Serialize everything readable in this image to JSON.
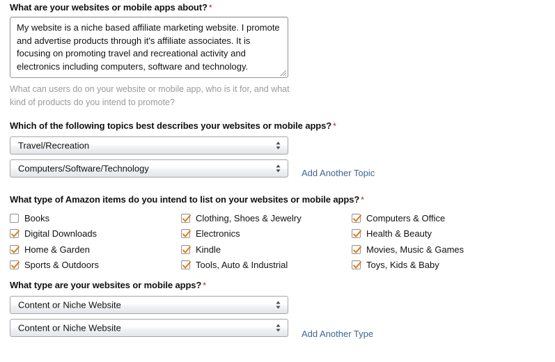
{
  "form": {
    "about": {
      "label": "What are your websites or mobile apps about?",
      "required_marker": "*",
      "textarea_value": "My website is a niche based affiliate marketing website. I promote and advertise products through it's affiliate associates. It is focusing on promoting travel and recreational activity and electronics including computers, software and technology.",
      "textarea_placeholder": "",
      "help_text": "What can users do on your website or mobile app, who is it for, and what kind of products do you intend to promote?",
      "resize_handle_icon": "resize-grip-icon"
    },
    "topics": {
      "label": "Which of the following topics best describes your websites or mobile apps?",
      "required_marker": "*",
      "selects": [
        {
          "value": "Travel/Recreation"
        },
        {
          "value": "Computers/Software/Technology"
        }
      ],
      "add_link": "Add Another Topic",
      "spinner_icon": "select-spinner-icon"
    },
    "items": {
      "label": "What type of Amazon items do you intend to list on your websites or mobile apps?",
      "required_marker": "*",
      "columns": [
        [
          {
            "label": "Books",
            "checked": false
          },
          {
            "label": "Digital Downloads",
            "checked": true
          },
          {
            "label": "Home & Garden",
            "checked": true
          },
          {
            "label": "Sports & Outdoors",
            "checked": true
          }
        ],
        [
          {
            "label": "Clothing, Shoes & Jewelry",
            "checked": true
          },
          {
            "label": "Electronics",
            "checked": true
          },
          {
            "label": "Kindle",
            "checked": true
          },
          {
            "label": "Tools, Auto & Industrial",
            "checked": true
          }
        ],
        [
          {
            "label": "Computers & Office",
            "checked": true
          },
          {
            "label": "Health & Beauty",
            "checked": true
          },
          {
            "label": "Movies, Music & Games",
            "checked": true
          },
          {
            "label": "Toys, Kids & Baby",
            "checked": true
          }
        ]
      ],
      "check_icon": "checkmark-icon"
    },
    "site_type": {
      "label": "What type are your websites or mobile apps?",
      "required_marker": "*",
      "selects": [
        {
          "value": "Content or Niche Website"
        },
        {
          "value": "Content or Niche Website"
        }
      ],
      "add_link": "Add Another Type",
      "spinner_icon": "select-spinner-icon"
    }
  },
  "colors": {
    "required_asterisk": "#cc1111",
    "link": "#3f6590",
    "checkmark": "#e07b17",
    "text": "#111111",
    "help_text": "#9a9a9a",
    "control_border": "#a6a6a6"
  }
}
